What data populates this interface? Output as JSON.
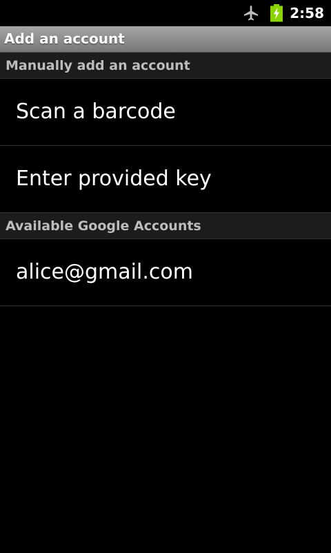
{
  "status_bar": {
    "time": "2:58",
    "icons": [
      "airplane-mode-icon",
      "battery-charging-icon"
    ],
    "battery_color": "#8bd400"
  },
  "title_bar": {
    "title": "Add an account"
  },
  "sections": [
    {
      "header": "Manually add an account",
      "items": [
        {
          "label": "Scan a barcode"
        },
        {
          "label": "Enter provided key"
        }
      ]
    },
    {
      "header": "Available Google Accounts",
      "items": [
        {
          "label": "alice@gmail.com"
        }
      ]
    }
  ]
}
